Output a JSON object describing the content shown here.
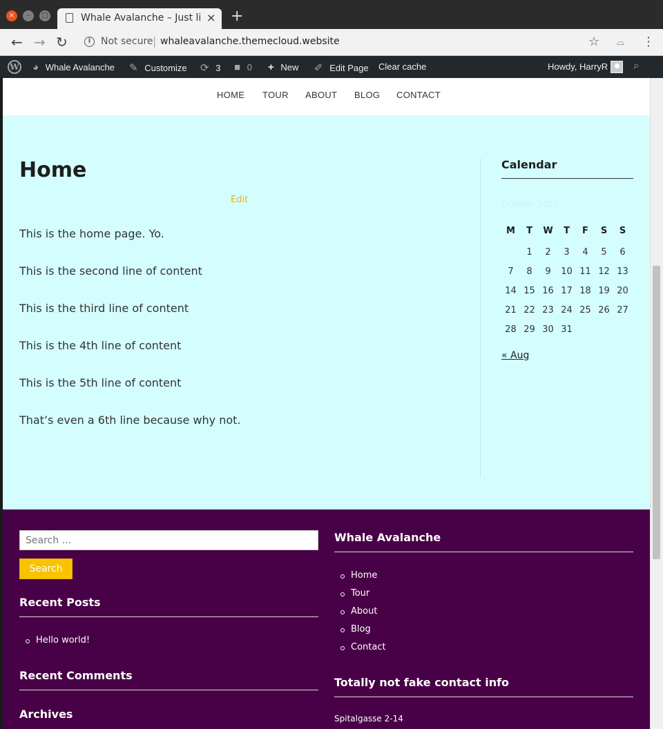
{
  "browser": {
    "tab_title": "Whale Avalanche – Just li",
    "tab_close": "×",
    "new_tab": "+",
    "security_label": "Not secure",
    "url": "whaleavalanche.themecloud.website"
  },
  "admin_bar": {
    "site_name": "Whale Avalanche",
    "customize": "Customize",
    "updates_count": "3",
    "comments_count": "0",
    "new_label": "New",
    "edit_page": "Edit Page",
    "clear_cache": "Clear cache",
    "howdy": "Howdy, HarryR"
  },
  "site_nav": {
    "items": [
      "HOME",
      "TOUR",
      "ABOUT",
      "BLOG",
      "CONTACT"
    ]
  },
  "main": {
    "title": "Home",
    "edit_label": "Edit",
    "paragraphs": [
      "This is the home page. Yo.",
      "This is the second line of content",
      "This is the third line of content",
      "This is the 4th line of content",
      "This is the 5th line of content",
      "That’s even a 6th line because why not."
    ]
  },
  "calendar": {
    "title": "Calendar",
    "caption": "October 2018",
    "weekday_headers": [
      "M",
      "T",
      "W",
      "T",
      "F",
      "S",
      "S"
    ],
    "weeks": [
      [
        "",
        "1",
        "2",
        "3",
        "4",
        "5",
        "6"
      ],
      [
        "7",
        "8",
        "9",
        "10",
        "11",
        "12",
        "13"
      ],
      [
        "14",
        "15",
        "16",
        "17",
        "18",
        "19",
        "20"
      ],
      [
        "21",
        "22",
        "23",
        "24",
        "25",
        "26",
        "27"
      ],
      [
        "28",
        "29",
        "30",
        "31",
        "",
        "",
        ""
      ]
    ],
    "prev_link": "« Aug"
  },
  "footer": {
    "search_placeholder": "Search …",
    "search_button": "Search",
    "recent_posts_title": "Recent Posts",
    "recent_posts": [
      "Hello world!"
    ],
    "recent_comments_title": "Recent Comments",
    "archives_title": "Archives",
    "site_title": "Whale Avalanche",
    "site_links": [
      "Home",
      "Tour",
      "About",
      "Blog",
      "Contact"
    ],
    "contact_title": "Totally not fake contact info",
    "address_partial": "Spitalgasse 2-14"
  },
  "colors": {
    "content_bg": "#d4fefe",
    "footer_bg": "#480046",
    "accent": "#f9c300",
    "admin_bar": "#23282d"
  }
}
